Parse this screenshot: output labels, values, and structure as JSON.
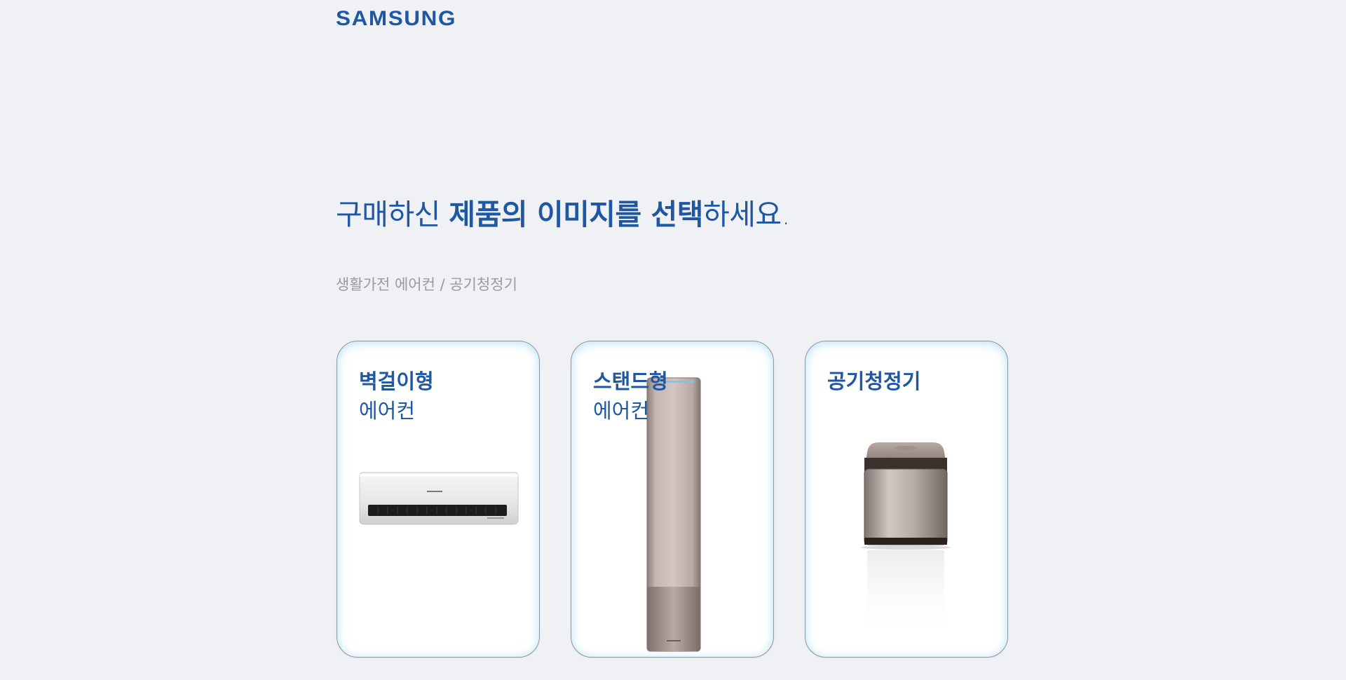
{
  "header": {
    "logo_text": "SAMSUNG"
  },
  "headline": {
    "part1": "구매하신 ",
    "bold1": "제품의 이미지",
    "part2": "를 ",
    "bold2": "선택",
    "part3": "하세요."
  },
  "breadcrumb": "생활가전 에어컨 / 공기청정기",
  "colors": {
    "brand": "#1f57a2",
    "background": "#eff1f5",
    "card_glow": "#78c8f0"
  },
  "cards": [
    {
      "title": "벽걸이형",
      "subtitle": "에어컨",
      "icon": "wall-mounted-air-conditioner-image"
    },
    {
      "title": "스탠드형",
      "subtitle": "에어컨",
      "icon": "stand-air-conditioner-image"
    },
    {
      "title": "공기청정기",
      "subtitle": "",
      "icon": "air-purifier-image"
    }
  ]
}
